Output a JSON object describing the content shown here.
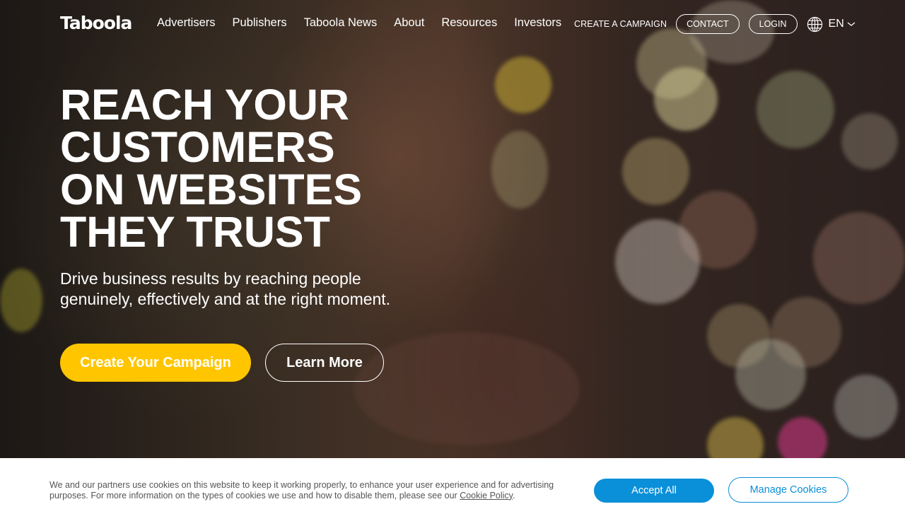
{
  "brand": {
    "logo_text": "Taboola"
  },
  "nav": {
    "items": [
      {
        "label": "Advertisers"
      },
      {
        "label": "Publishers"
      },
      {
        "label": "Taboola News"
      },
      {
        "label": "About"
      },
      {
        "label": "Resources"
      },
      {
        "label": "Investors"
      }
    ]
  },
  "header_actions": {
    "create_campaign": "CREATE A CAMPAIGN",
    "contact": "CONTACT",
    "login": "LOGIN",
    "language": "EN",
    "language_icon": "globe-icon",
    "language_caret_icon": "chevron-down-icon"
  },
  "hero": {
    "headline_lines": [
      "REACH YOUR",
      "CUSTOMERS",
      "ON WEBSITES",
      "THEY TRUST"
    ],
    "subtext": "Drive business results by reaching people genuinely, effectively and at the right moment.",
    "primary_cta": "Create Your Campaign",
    "secondary_cta": "Learn More"
  },
  "cookie_banner": {
    "text": "We and our partners use cookies on this website to keep it working properly, to enhance your user experience and for advertising purposes. For more information on the types of cookies we use and how to disable them, please see our",
    "policy_link": "Cookie Policy",
    "text_end": ".",
    "accept_label": "Accept All",
    "manage_label": "Manage Cookies"
  },
  "colors": {
    "primary_cta_bg": "#ffc600",
    "cookie_accent": "#0a8fd9",
    "header_text": "#ffffff"
  }
}
